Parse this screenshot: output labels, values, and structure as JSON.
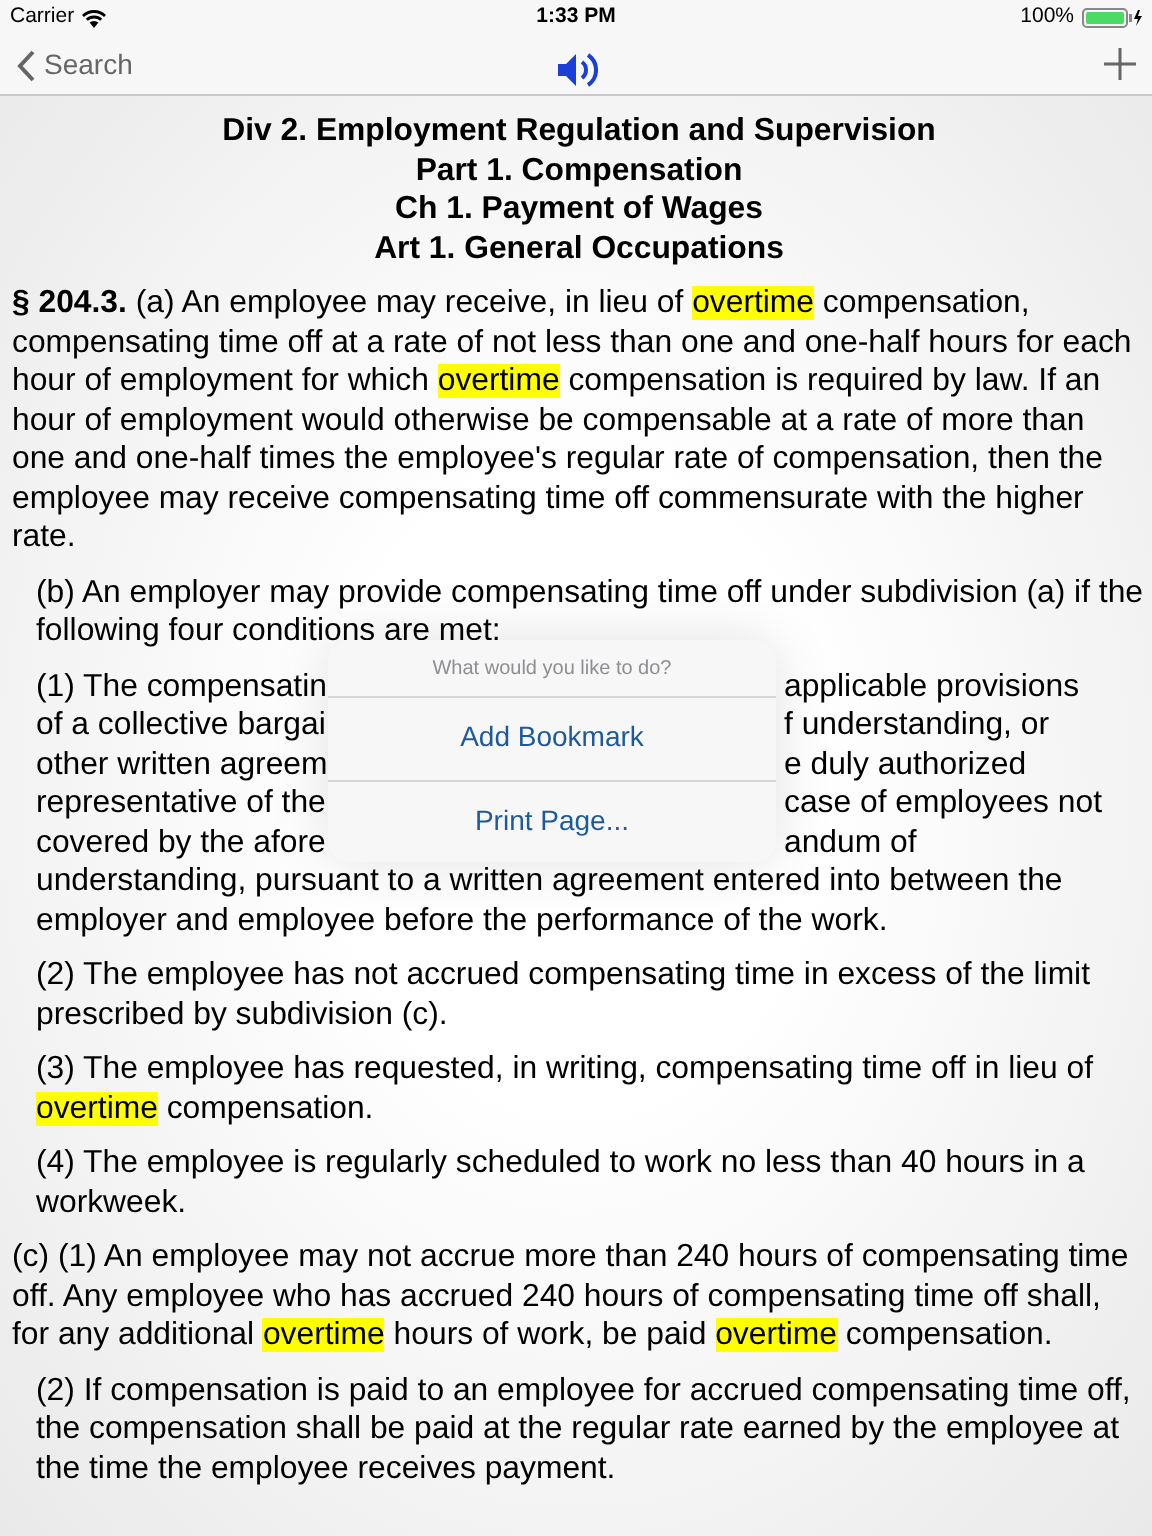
{
  "status_bar": {
    "carrier": "Carrier",
    "time": "1:33 PM",
    "battery": "100%"
  },
  "nav_bar": {
    "back_label": "Search"
  },
  "headings": [
    "Div 2. Employment Regulation and Supervision",
    "Part 1. Compensation",
    "Ch 1. Payment of Wages",
    "Art 1. General Occupations"
  ],
  "paragraphs": [
    {
      "kind": "text",
      "segments": [
        {
          "text": "**§ 204.3.** (a) An employee may receive, in lieu of ",
          "highlighted": false
        },
        {
          "text": "overtime",
          "highlighted": true
        },
        {
          "text": " compensation, compensating time off at a rate of not less than one and one-half hours for each hour of employment for which ",
          "highlighted": false
        },
        {
          "text": "overtime",
          "highlighted": true
        },
        {
          "text": " compensation is required by law. If an hour of employment would otherwise be compensable at a rate of more than one and one-half times the employee's regular rate of compensation, then the employee may receive compensating time off commensurate with the higher rate.",
          "highlighted": false
        }
      ],
      "children": [
        {
          "kind": "text",
          "segments": [
            {
              "text": "(b) An employer may provide compensating time off under subdivision (a) if the following four conditions are met:",
              "highlighted": false
            }
          ],
          "children": [
            {
              "kind": "covered",
              "lines": [
                {
                  "left": "(1) The compensatin",
                  "right": "applicable provisions"
                },
                {
                  "left": "of a collective bargai",
                  "right": "f understanding, or"
                },
                {
                  "left": "other written agreem",
                  "right": "e duly authorized"
                },
                {
                  "left": "representative of the",
                  "right": "case of employees not"
                },
                {
                  "left": "covered by the afore",
                  "right": "andum of"
                }
              ],
              "rest": "understanding, pursuant to a written agreement entered into between the employer and employee before the performance of the work."
            },
            {
              "kind": "text",
              "segments": [
                {
                  "text": "(2) The employee has not accrued compensating time in excess of the limit prescribed by subdivision (c).",
                  "highlighted": false
                }
              ]
            },
            {
              "kind": "text",
              "segments": [
                {
                  "text": "(3) The employee has requested, in writing, compensating time off in lieu of ",
                  "highlighted": false
                },
                {
                  "text": "overtime",
                  "highlighted": true
                },
                {
                  "text": " compensation.",
                  "highlighted": false
                }
              ]
            },
            {
              "kind": "text",
              "segments": [
                {
                  "text": "(4) The employee is regularly scheduled to work no less than 40 hours in a workweek.",
                  "highlighted": false
                }
              ]
            }
          ]
        }
      ]
    },
    {
      "kind": "text",
      "segments": [
        {
          "text": "(c) (1) An employee may not accrue more than 240 hours of compensating time off. Any employee who has accrued 240 hours of compensating time off shall, for any additional ",
          "highlighted": false
        },
        {
          "text": "overtime",
          "highlighted": true
        },
        {
          "text": " hours of work, be paid ",
          "highlighted": false
        },
        {
          "text": "overtime",
          "highlighted": true
        },
        {
          "text": " compensation.",
          "highlighted": false
        }
      ],
      "children": [
        {
          "kind": "text",
          "segments": [
            {
              "text": "(2) If compensation is paid to an employee for accrued compensating time off, the compensation shall be paid at the regular rate earned by the employee at the time the employee receives payment.",
              "highlighted": false
            }
          ]
        }
      ]
    }
  ],
  "popover": {
    "title": "What would you like to do?",
    "actions": [
      "Add Bookmark",
      "Print Page..."
    ]
  }
}
